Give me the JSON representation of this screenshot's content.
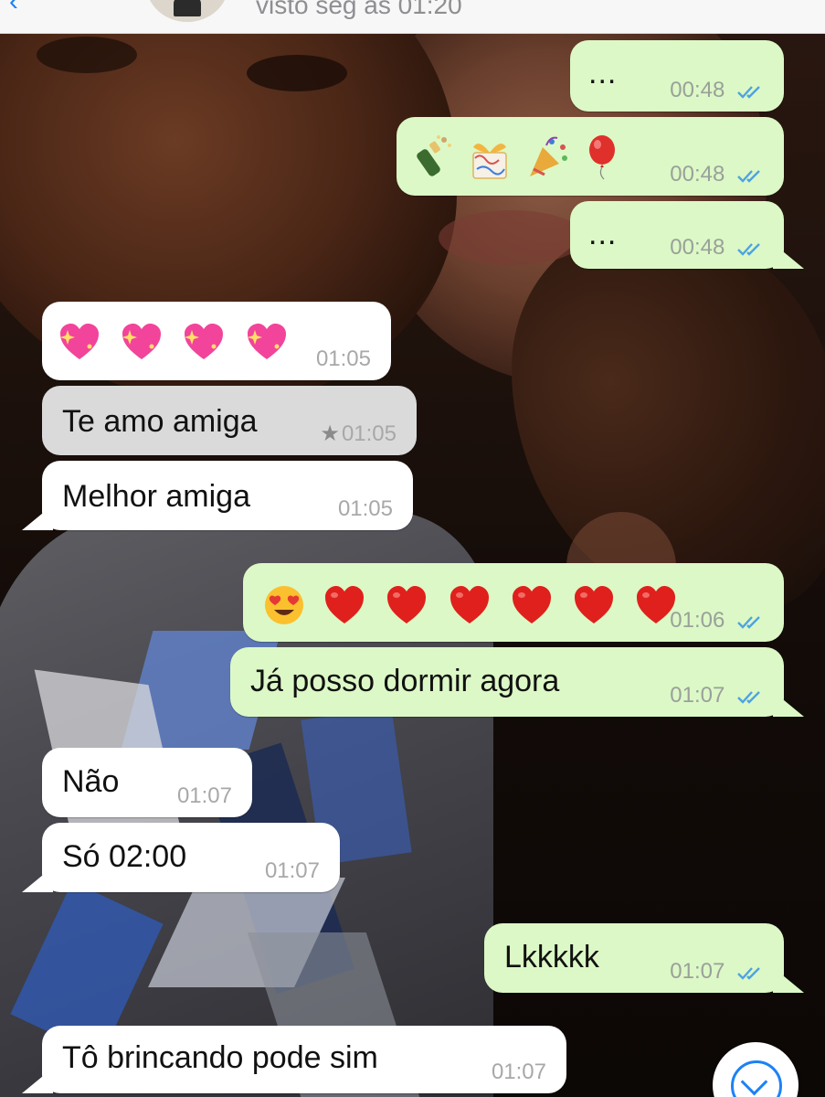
{
  "header": {
    "status": "visto seg às 01:20"
  },
  "colors": {
    "outgoing_bubble": "#dcf8c6",
    "incoming_bubble": "#ffffff",
    "selected_bubble": "#dadada",
    "read_ticks": "#4fa3e0",
    "accent": "#1d82f5"
  },
  "messages": [
    {
      "direction": "out",
      "text": "...",
      "time": "00:48",
      "status": "read"
    },
    {
      "direction": "out",
      "emoji": [
        "bottle-with-popping-cork",
        "wrapped-gift",
        "party-popper",
        "balloon"
      ],
      "time": "00:48",
      "status": "read"
    },
    {
      "direction": "out",
      "text": "...",
      "time": "00:48",
      "status": "read"
    },
    {
      "direction": "in",
      "emoji": [
        "sparkling-heart",
        "sparkling-heart",
        "sparkling-heart",
        "sparkling-heart"
      ],
      "time": "01:05"
    },
    {
      "direction": "in",
      "text": "Te amo amiga",
      "time": "01:05",
      "starred": true,
      "selected": true
    },
    {
      "direction": "in",
      "text": "Melhor amiga",
      "time": "01:05"
    },
    {
      "direction": "out",
      "emoji": [
        "smiling-face-with-heart-eyes",
        "red-heart",
        "red-heart",
        "red-heart",
        "red-heart",
        "red-heart",
        "red-heart"
      ],
      "time": "01:06",
      "status": "read"
    },
    {
      "direction": "out",
      "text": "Já posso dormir agora",
      "time": "01:07",
      "status": "read"
    },
    {
      "direction": "in",
      "text": "Não",
      "time": "01:07"
    },
    {
      "direction": "in",
      "text": "Só 02:00",
      "time": "01:07"
    },
    {
      "direction": "out",
      "text": "Lkkkkk",
      "time": "01:07",
      "status": "read"
    },
    {
      "direction": "in",
      "text": "Tô brincando pode sim",
      "time": "01:07"
    }
  ],
  "scroll_button": {
    "icon": "chevron-down-circle-icon"
  }
}
